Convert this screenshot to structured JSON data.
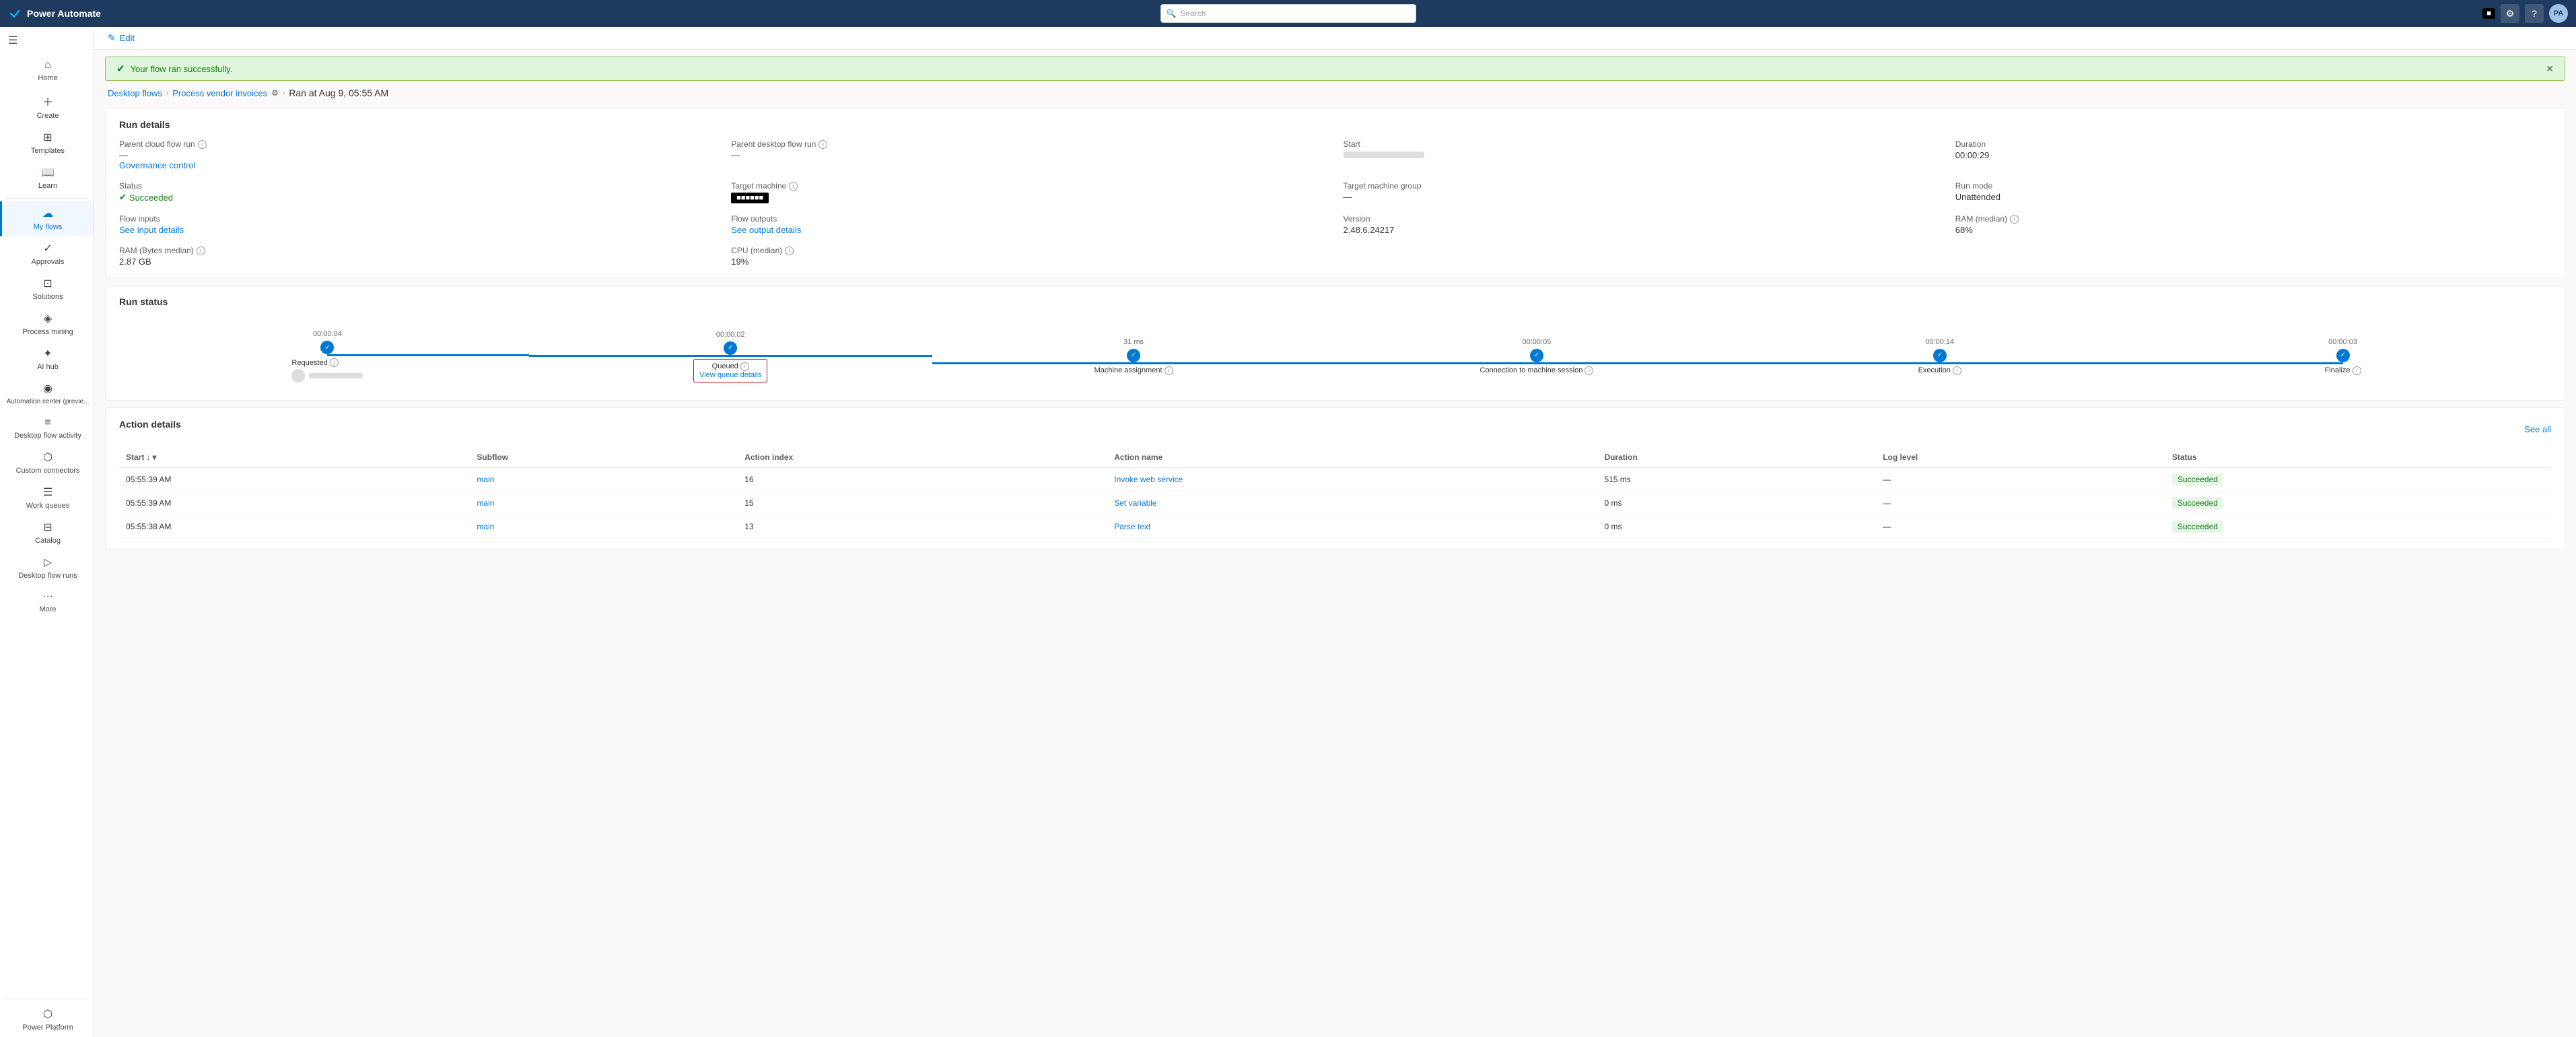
{
  "topbar": {
    "logo_text": "Power Automate",
    "search_placeholder": "Search",
    "label_box": "■",
    "avatar_initials": "PA"
  },
  "sidebar": {
    "toggle_icon": "☰",
    "items": [
      {
        "id": "home",
        "icon": "⌂",
        "label": "Home",
        "active": false
      },
      {
        "id": "create",
        "icon": "+",
        "label": "Create",
        "active": false
      },
      {
        "id": "templates",
        "icon": "⊞",
        "label": "Templates",
        "active": false
      },
      {
        "id": "learn",
        "icon": "?",
        "label": "Learn",
        "active": false
      },
      {
        "id": "my-flows",
        "icon": "☁",
        "label": "My flows",
        "active": true
      },
      {
        "id": "approvals",
        "icon": "✓",
        "label": "Approvals",
        "active": false
      },
      {
        "id": "solutions",
        "icon": "⊡",
        "label": "Solutions",
        "active": false
      },
      {
        "id": "process-mining",
        "icon": "◈",
        "label": "Process mining",
        "active": false
      },
      {
        "id": "ai-hub",
        "icon": "✦",
        "label": "AI hub",
        "active": false
      },
      {
        "id": "automation-center",
        "icon": "◉",
        "label": "Automation center (previe...",
        "active": false
      },
      {
        "id": "desktop-flow-activity",
        "icon": "≡",
        "label": "Desktop flow activity",
        "active": false
      },
      {
        "id": "custom-connectors",
        "icon": "⬡",
        "label": "Custom connectors",
        "active": false
      },
      {
        "id": "work-queues",
        "icon": "☰",
        "label": "Work queues",
        "active": false
      },
      {
        "id": "catalog",
        "icon": "⊟",
        "label": "Catalog",
        "active": false
      },
      {
        "id": "desktop-flow-runs",
        "icon": "▷",
        "label": "Desktop flow runs",
        "active": false
      },
      {
        "id": "more",
        "icon": "···",
        "label": "More",
        "active": false
      }
    ],
    "bottom_items": [
      {
        "id": "power-platform",
        "icon": "⬡",
        "label": "Power Platform",
        "active": false
      }
    ]
  },
  "edit_bar": {
    "icon": "✎",
    "label": "Edit"
  },
  "success_banner": {
    "icon": "✓",
    "message": "Your flow ran successfully."
  },
  "breadcrumb": {
    "desktop_flows": "Desktop flows",
    "flow_name": "Process vendor invoices",
    "ran_at": "Ran at Aug 9, 05:55 AM"
  },
  "run_details": {
    "title": "Run details",
    "fields": [
      {
        "label": "Parent cloud flow run",
        "info": true,
        "value": "—",
        "sub_value": "Governance control",
        "is_link": true
      },
      {
        "label": "Parent desktop flow run",
        "info": true,
        "value": "—"
      },
      {
        "label": "Start",
        "info": false,
        "value": "blurred"
      },
      {
        "label": "Duration",
        "info": false,
        "value": "00:00:29"
      },
      {
        "label": "Status",
        "info": false,
        "value": "Succeeded",
        "is_success": true
      },
      {
        "label": "Target machine",
        "info": true,
        "value": "machine_badge"
      },
      {
        "label": "Target machine group",
        "info": false,
        "value": "—"
      },
      {
        "label": "Run mode",
        "info": false,
        "value": "Unattended"
      },
      {
        "label": "Flow inputs",
        "info": false,
        "value": "See input details",
        "is_link": true
      },
      {
        "label": "Flow outputs",
        "info": false,
        "value": "See output details",
        "is_link": true
      },
      {
        "label": "Version",
        "info": false,
        "value": "2.48.6.24217"
      },
      {
        "label": "RAM (median)",
        "info": true,
        "value": "68%"
      },
      {
        "label": "RAM (Bytes median)",
        "info": true,
        "value": "2.87 GB"
      },
      {
        "label": "CPU (median)",
        "info": true,
        "value": "19%"
      }
    ]
  },
  "run_status": {
    "title": "Run status",
    "stages": [
      {
        "id": "requested",
        "label": "Requested",
        "info": true,
        "duration": "00:00:04",
        "has_avatar": true,
        "has_timestamp": true,
        "highlight": false,
        "sublabel": ""
      },
      {
        "id": "queued",
        "label": "Queued",
        "info": true,
        "duration": "00:00:02",
        "has_avatar": false,
        "has_timestamp": false,
        "highlight": true,
        "sublabel": "View queue details"
      },
      {
        "id": "machine-assignment",
        "label": "Machine assignment",
        "info": true,
        "duration": "31 ms",
        "has_avatar": false,
        "has_timestamp": false,
        "highlight": false,
        "sublabel": ""
      },
      {
        "id": "connection-to-machine",
        "label": "Connection to machine session",
        "info": true,
        "duration": "00:00:05",
        "has_avatar": false,
        "has_timestamp": false,
        "highlight": false,
        "sublabel": ""
      },
      {
        "id": "execution",
        "label": "Execution",
        "info": true,
        "duration": "00:00:14",
        "has_avatar": false,
        "has_timestamp": false,
        "highlight": false,
        "sublabel": ""
      },
      {
        "id": "finalize",
        "label": "Finalize",
        "info": true,
        "duration": "00:00:03",
        "has_avatar": false,
        "has_timestamp": false,
        "highlight": false,
        "sublabel": ""
      }
    ]
  },
  "action_details": {
    "title": "Action details",
    "see_all_label": "See all",
    "columns": [
      "Start",
      "Subflow",
      "Action index",
      "Action name",
      "Duration",
      "Log level",
      "Status"
    ],
    "rows": [
      {
        "start": "05:55:39 AM",
        "subflow": "main",
        "action_index": "16",
        "action_name": "Invoke web service",
        "duration": "515 ms",
        "log_level": "—",
        "status": "Succeeded"
      },
      {
        "start": "05:55:39 AM",
        "subflow": "main",
        "action_index": "15",
        "action_name": "Set variable",
        "duration": "0 ms",
        "log_level": "—",
        "status": "Succeeded"
      },
      {
        "start": "05:55:38 AM",
        "subflow": "main",
        "action_index": "13",
        "action_name": "Parse text",
        "duration": "0 ms",
        "log_level": "—",
        "status": "Succeeded"
      }
    ]
  }
}
